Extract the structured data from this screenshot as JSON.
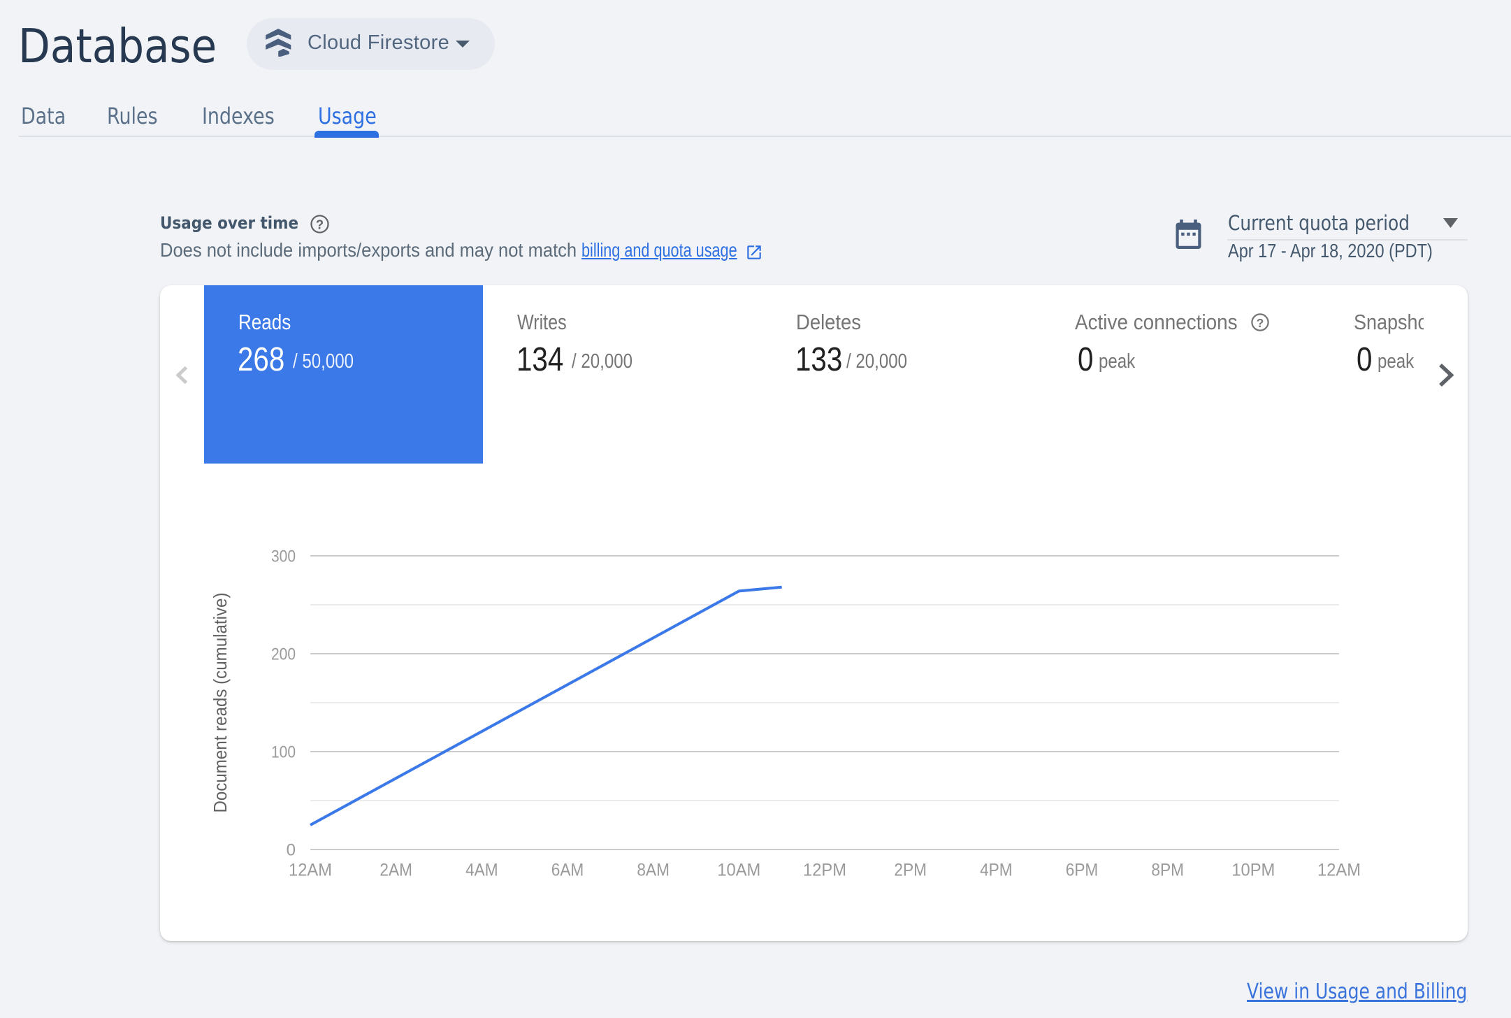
{
  "header": {
    "title": "Database",
    "product_selector": {
      "label": "Cloud Firestore"
    }
  },
  "tabs": [
    {
      "label": "Data",
      "active": false
    },
    {
      "label": "Rules",
      "active": false
    },
    {
      "label": "Indexes",
      "active": false
    },
    {
      "label": "Usage",
      "active": true
    }
  ],
  "section": {
    "title": "Usage over time",
    "subtitle_prefix": "Does not include imports/exports and may not match ",
    "subtitle_link": "billing and quota usage"
  },
  "quota": {
    "label": "Current quota period",
    "range": "Apr 17 - Apr 18, 2020 (PDT)"
  },
  "metrics": [
    {
      "label": "Reads",
      "value": "268",
      "suffix": "/ 50,000",
      "active": true
    },
    {
      "label": "Writes",
      "value": "134",
      "suffix": "/ 20,000",
      "active": false
    },
    {
      "label": "Deletes",
      "value": "133",
      "suffix": "/ 20,000",
      "active": false
    },
    {
      "label": "Active connections",
      "value": "0",
      "suffix": "peak",
      "active": false,
      "help": true
    },
    {
      "label": "Snapshot listeners",
      "value": "0",
      "suffix": "peak",
      "active": false
    }
  ],
  "footer": {
    "link": "View in Usage and Billing"
  },
  "colors": {
    "accent_blue": "#2e70e2",
    "metric_active_bg": "#3b78e8",
    "navy_title": "#263951",
    "slate": "#4a5f7d",
    "page_background": "#f1f3f6"
  },
  "chart_data": {
    "type": "line",
    "title": "Usage over time",
    "xlabel": "",
    "ylabel": "Document reads (cumulative)",
    "x_tick_labels": [
      "12AM",
      "2AM",
      "4AM",
      "6AM",
      "8AM",
      "10AM",
      "12PM",
      "2PM",
      "4PM",
      "6PM",
      "8PM",
      "10PM",
      "12AM"
    ],
    "x_tick_hours": [
      0,
      2,
      4,
      6,
      8,
      10,
      12,
      14,
      16,
      18,
      20,
      22,
      24
    ],
    "xlim_hours": [
      0,
      24
    ],
    "y_ticks": [
      0,
      100,
      200,
      300
    ],
    "y_minor_ticks": [
      50,
      150,
      250
    ],
    "ylim": [
      0,
      300
    ],
    "legend": "none",
    "grid": "horizontal",
    "series": [
      {
        "name": "Reads",
        "color": "#3b78e8",
        "points": [
          {
            "hour": 0,
            "value": 25
          },
          {
            "hour": 10,
            "value": 264
          },
          {
            "hour": 11,
            "value": 268
          }
        ]
      }
    ]
  }
}
